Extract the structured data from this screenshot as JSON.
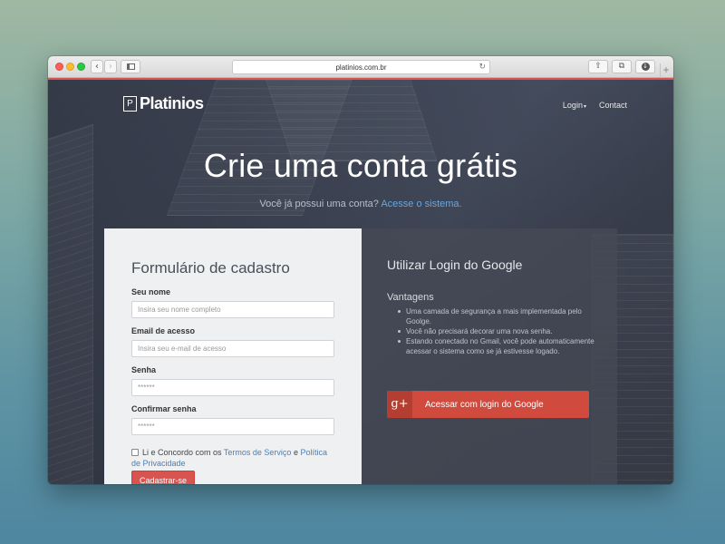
{
  "browser": {
    "url": "platinios.com.br",
    "back_glyph": "‹",
    "forward_glyph": "›",
    "reload_glyph": "↻",
    "share_glyph": "⇧",
    "tabs_glyph": "⧉",
    "download_glyph": "↓",
    "newtab_glyph": "+",
    "accent_color": "#d9534f"
  },
  "header": {
    "logo_mark": "P",
    "logo_text": "Platinios",
    "nav": {
      "login": "Login",
      "login_caret": "▾",
      "contact": "Contact"
    }
  },
  "hero": {
    "title": "Crie uma conta grátis",
    "subtitle_text": "Você já possui uma conta?",
    "subtitle_link": "Acesse o sistema."
  },
  "form": {
    "title": "Formulário de cadastro",
    "fields": {
      "name": {
        "label": "Seu nome",
        "placeholder": "Insira seu nome completo"
      },
      "email": {
        "label": "Email de acesso",
        "placeholder": "Insira seu e-mail de acesso"
      },
      "password": {
        "label": "Senha",
        "placeholder": "******"
      },
      "confirm": {
        "label": "Confirmar senha",
        "placeholder": "******"
      }
    },
    "terms": {
      "prefix": "Li e Concordo com os",
      "terms_link": "Termos de Serviço",
      "and": "e",
      "privacy_link": "Política de Privacidade"
    },
    "submit_label": "Cadastrar-se"
  },
  "google": {
    "title": "Utilizar Login do Google",
    "advantages_heading": "Vantagens",
    "advantages": [
      "Uma camada de segurança a mais implementada pelo Goolge.",
      "Você não precisará decorar uma nova senha.",
      "Estando conectado no Gmail, você pode automaticamente acessar o sistema como se já estivesse logado."
    ],
    "button_icon": "g+",
    "button_label": "Acessar com login do Google",
    "button_color": "#d04b3d"
  }
}
